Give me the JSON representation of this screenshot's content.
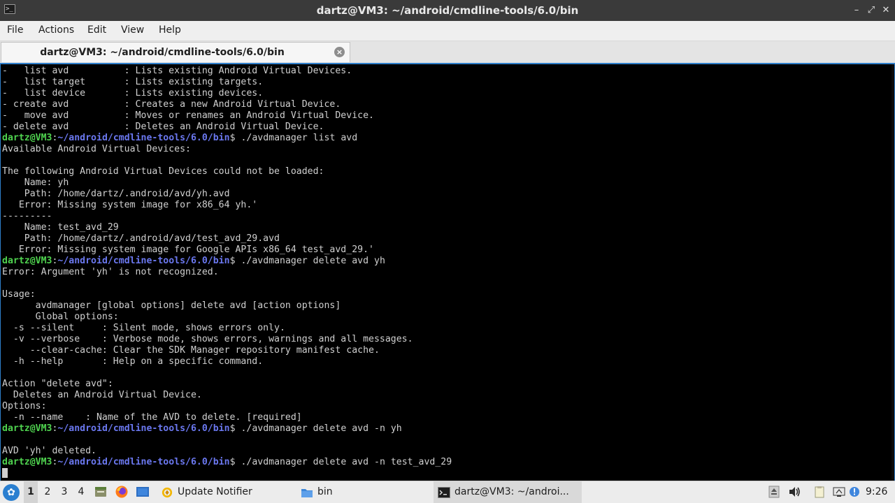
{
  "window": {
    "title": "dartz@VM3: ~/android/cmdline-tools/6.0/bin"
  },
  "menu": [
    "File",
    "Actions",
    "Edit",
    "View",
    "Help"
  ],
  "tab": {
    "label": "dartz@VM3: ~/android/cmdline-tools/6.0/bin",
    "close_icon": "close-icon"
  },
  "terminal": {
    "prompt_user": "dartz@VM3",
    "prompt_sep": ":",
    "prompt_path": "~/android/cmdline-tools/6.0/bin",
    "prompt_end": "$ ",
    "lines": [
      {
        "text": "-   list avd          : Lists existing Android Virtual Devices."
      },
      {
        "text": "-   list target       : Lists existing targets."
      },
      {
        "text": "-   list device       : Lists existing devices."
      },
      {
        "text": "- create avd          : Creates a new Android Virtual Device."
      },
      {
        "text": "-   move avd          : Moves or renames an Android Virtual Device."
      },
      {
        "text": "- delete avd          : Deletes an Android Virtual Device."
      },
      {
        "cmd": "./avdmanager list avd"
      },
      {
        "text": "Available Android Virtual Devices:"
      },
      {
        "text": ""
      },
      {
        "text": "The following Android Virtual Devices could not be loaded:"
      },
      {
        "text": "    Name: yh"
      },
      {
        "text": "    Path: /home/dartz/.android/avd/yh.avd"
      },
      {
        "text": "   Error: Missing system image for x86_64 yh.'"
      },
      {
        "text": "---------"
      },
      {
        "text": "    Name: test_avd_29"
      },
      {
        "text": "    Path: /home/dartz/.android/avd/test_avd_29.avd"
      },
      {
        "text": "   Error: Missing system image for Google APIs x86_64 test_avd_29.'"
      },
      {
        "cmd": "./avdmanager delete avd yh"
      },
      {
        "text": "Error: Argument 'yh' is not recognized."
      },
      {
        "text": ""
      },
      {
        "text": "Usage:"
      },
      {
        "text": "      avdmanager [global options] delete avd [action options]"
      },
      {
        "text": "      Global options:"
      },
      {
        "text": "  -s --silent     : Silent mode, shows errors only."
      },
      {
        "text": "  -v --verbose    : Verbose mode, shows errors, warnings and all messages."
      },
      {
        "text": "     --clear-cache: Clear the SDK Manager repository manifest cache."
      },
      {
        "text": "  -h --help       : Help on a specific command."
      },
      {
        "text": ""
      },
      {
        "text": "Action \"delete avd\":"
      },
      {
        "text": "  Deletes an Android Virtual Device."
      },
      {
        "text": "Options:"
      },
      {
        "text": "  -n --name    : Name of the AVD to delete. [required]"
      },
      {
        "cmd": "./avdmanager delete avd -n yh"
      },
      {
        "text": ""
      },
      {
        "text": "AVD 'yh' deleted."
      },
      {
        "cmd": "./avdmanager delete avd -n test_avd_29"
      },
      {
        "cursor": true
      }
    ]
  },
  "taskbar": {
    "start_icon": "lxqt-start-icon",
    "workspaces": [
      "1",
      "2",
      "3",
      "4"
    ],
    "active_workspace": "1",
    "quicklaunch": [
      "file-manager-icon",
      "firefox-icon",
      "show-desktop-icon"
    ],
    "tasks": [
      {
        "label": "Update Notifier",
        "icon": "update-notifier-icon",
        "active": false
      },
      {
        "label": "bin",
        "icon": "folder-icon",
        "active": false
      },
      {
        "label": "dartz@VM3: ~/androi...",
        "icon": "terminal-icon",
        "active": true
      }
    ],
    "tray": [
      "eject-icon",
      "volume-icon",
      "clipboard-icon",
      "monitor-icon",
      "update-alert-icon"
    ],
    "clock": "9:26"
  }
}
